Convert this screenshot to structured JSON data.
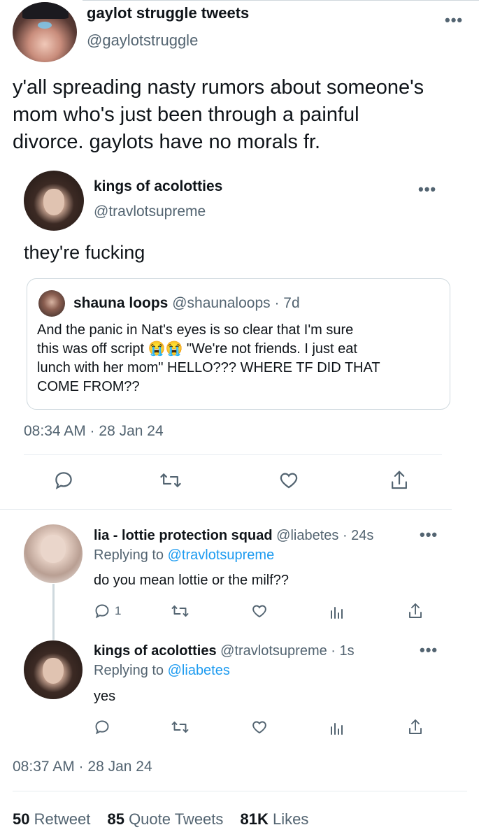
{
  "main_tweet": {
    "name": "gaylot struggle tweets",
    "handle": "@gaylotstruggle",
    "text_lines": [
      "y'all spreading nasty rumors about someone's",
      "mom who's just been through a painful",
      "divorce. gaylots have no morals fr."
    ],
    "more": "•••"
  },
  "embedded_tweet": {
    "name": "kings of acolotties",
    "handle": "@travlotsupreme",
    "text": "they're fucking",
    "more": "•••",
    "quote": {
      "name": "shauna loops",
      "handle": "@shaunaloops",
      "time": "· 7d",
      "lines": [
        "And the panic in Nat's eyes is so clear that I'm sure",
        "this was off script 😭😭 \"We're not friends. I just eat",
        "lunch with her mom\" HELLO??? WHERE TF DID THAT",
        "COME FROM??"
      ]
    },
    "timestamp": "08:34 AM · 28 Jan 24"
  },
  "replies": [
    {
      "name": "lia - lottie protection squad",
      "handle": "@liabetes",
      "time": "· 24s",
      "replying_prefix": "Replying to",
      "replying_to": "@travlotsupreme",
      "text": "do you mean lottie or the milf??",
      "reply_count": "1",
      "more": "•••"
    },
    {
      "name": "kings of acolotties",
      "handle": "@travlotsupreme",
      "time": "· 1s",
      "replying_prefix": "Replying to",
      "replying_to": "@liabetes",
      "text": "yes",
      "reply_count": "",
      "more": "•••"
    }
  ],
  "footer": {
    "timestamp": "08:37 AM · 28 Jan 24",
    "retweets_count": "50",
    "retweets_label": "Retweet",
    "quotes_count": "85",
    "quotes_label": "Quote Tweets",
    "likes_count": "81K",
    "likes_label": "Likes"
  },
  "colors": {
    "text": "#0f1419",
    "muted": "#536471",
    "link": "#1d9bf0",
    "border": "#cfd9de"
  }
}
